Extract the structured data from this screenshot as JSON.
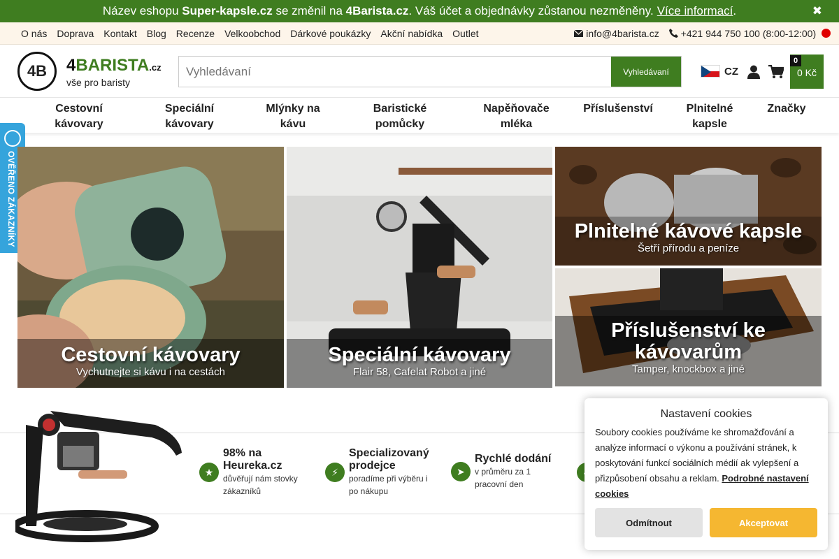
{
  "announcement": {
    "part1": "Název eshopu ",
    "old_name": "Super-kapsle.cz",
    "part2": " se změnil na ",
    "new_name": "4Barista.cz",
    "part3": ". Váš účet a objednávky zůstanou nezměněny.",
    "link": "Více informací",
    "end": ".",
    "close": "✖"
  },
  "toplinks": {
    "items": [
      "O nás",
      "Doprava",
      "Kontakt",
      "Blog",
      "Recenze",
      "Velkoobchod",
      "Dárkové poukázky",
      "Akční nabídka",
      "Outlet"
    ],
    "email": "info@4barista.cz",
    "phone": "+421 944 750 100 (8:00-12:00)"
  },
  "header": {
    "logo_mark": "4B",
    "brand_prefix": "4",
    "brand_main": "BARISTA",
    "brand_tld": ".cz",
    "tagline": "vše pro baristy",
    "search_placeholder": "Vyhledávaní",
    "search_button": "Vyhledávaní",
    "lang": "CZ",
    "cart_count": "0",
    "cart_total": "0 Kč"
  },
  "categories": [
    {
      "l1": "Cestovní",
      "l2": "kávovary"
    },
    {
      "l1": "Speciální",
      "l2": "kávovary"
    },
    {
      "l1": "Mlýnky na",
      "l2": "kávu"
    },
    {
      "l1": "Baristické",
      "l2": "pomůcky"
    },
    {
      "l1": "Napěňovače",
      "l2": "mléka"
    },
    {
      "l1": "Příslušenství",
      "l2": ""
    },
    {
      "l1": "Plnitelné",
      "l2": "kapsle"
    },
    {
      "l1": "Značky",
      "l2": ""
    }
  ],
  "badge": "OVĚŘENO ZÁKAZNÍKY",
  "tiles": [
    {
      "title": "Cestovní kávovary",
      "subtitle": "Vychutnejte si kávu i na cestách"
    },
    {
      "title": "Speciální kávovary",
      "subtitle": "Flair 58, Cafelat Robot a jiné"
    },
    {
      "title": "Plnitelné kávové kapsle",
      "subtitle": "Šetří přírodu a peníze"
    },
    {
      "title_l1": "Příslušenství ke",
      "title_l2": "kávovarům",
      "subtitle": "Tamper, knockbox a jiné"
    }
  ],
  "benefits": [
    {
      "title_l1": "98% na",
      "title_l2": "Heureka.cz",
      "sub_l1": "důvěřují nám stovky",
      "sub_l2": "zákazníků",
      "icon": "star-icon"
    },
    {
      "title_l1": "Specializovaný",
      "title_l2": "prodejce",
      "sub_l1": "poradíme při výběru i",
      "sub_l2": "po nákupu",
      "icon": "bolt-icon"
    },
    {
      "title_l1": "Rychlé dodání",
      "title_l2": "",
      "sub_l1": "v průměru za 1",
      "sub_l2": "pracovní den",
      "icon": "send-icon"
    }
  ],
  "cookie": {
    "title": "Nastavení cookies",
    "text": "Soubory cookies používáme ke shromažďování a analýze informací o výkonu a používání stránek, k poskytování funkcí sociálních médií ak vylepšení a přizpůsobení obsahu a reklam. ",
    "link": "Podrobné nastavení cookies",
    "deny": "Odmítnout",
    "accept": "Akceptovat"
  },
  "colors": {
    "brand_green": "#3f7d20",
    "accept_orange": "#f5b731",
    "badge_blue": "#35a4dc"
  }
}
